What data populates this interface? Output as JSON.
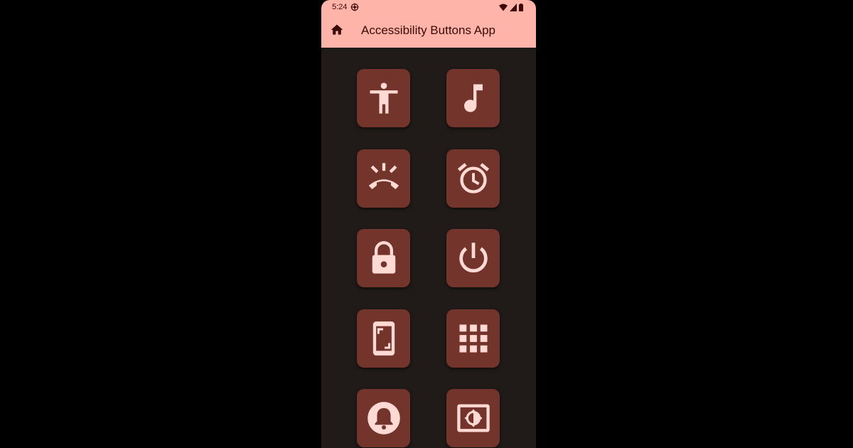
{
  "status_bar": {
    "time": "5:24",
    "icons": [
      "settings-gear-icon",
      "wifi-icon",
      "signal-icon",
      "battery-icon"
    ]
  },
  "app_bar": {
    "title": "Accessibility Buttons App",
    "nav_icon": "home-icon"
  },
  "buttons": [
    {
      "icon": "accessibility-icon"
    },
    {
      "icon": "music-note-icon"
    },
    {
      "icon": "ringing-phone-icon"
    },
    {
      "icon": "alarm-clock-icon"
    },
    {
      "icon": "lock-icon"
    },
    {
      "icon": "power-icon"
    },
    {
      "icon": "screenshot-phone-icon"
    },
    {
      "icon": "keypad-grid-icon"
    },
    {
      "icon": "notification-bell-icon"
    },
    {
      "icon": "brightness-icon"
    }
  ],
  "colors": {
    "app_bar_bg": "#ffb4a9",
    "app_bar_fg": "#3b0907",
    "screen_bg": "#201a19",
    "tile_bg": "#73342b",
    "icon_fg": "#ffdad5"
  }
}
